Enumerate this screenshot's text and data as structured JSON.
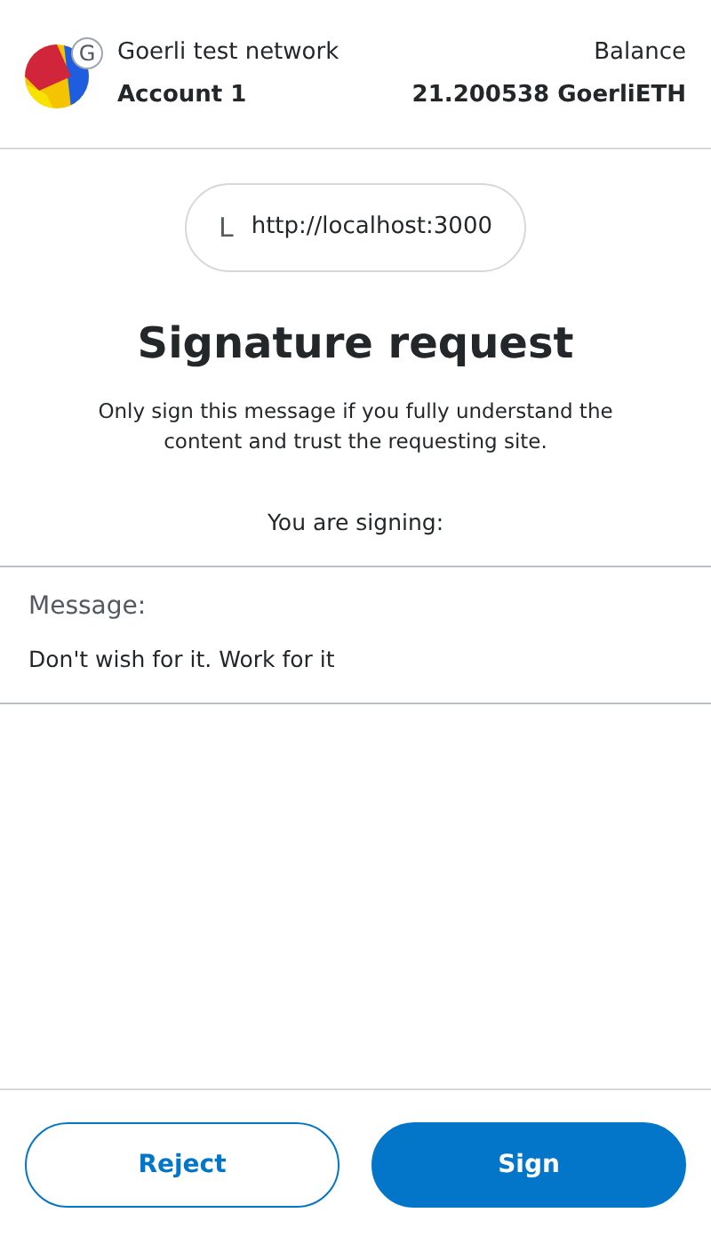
{
  "header": {
    "network": "Goerli test network",
    "network_badge": "G",
    "account": "Account 1",
    "balance_label": "Balance",
    "balance": "21.200538 GoerliETH"
  },
  "origin": {
    "icon_letter": "L",
    "url": "http://localhost:3000"
  },
  "title": "Signature request",
  "description": "Only sign this message if you fully understand the content and trust the requesting site.",
  "signing_label": "You are signing:",
  "message": {
    "label": "Message:",
    "text": "Don't wish for it. Work for it"
  },
  "buttons": [
    {
      "kind": "secondary",
      "label": "Reject"
    },
    {
      "kind": "primary",
      "label": "Sign"
    }
  ]
}
